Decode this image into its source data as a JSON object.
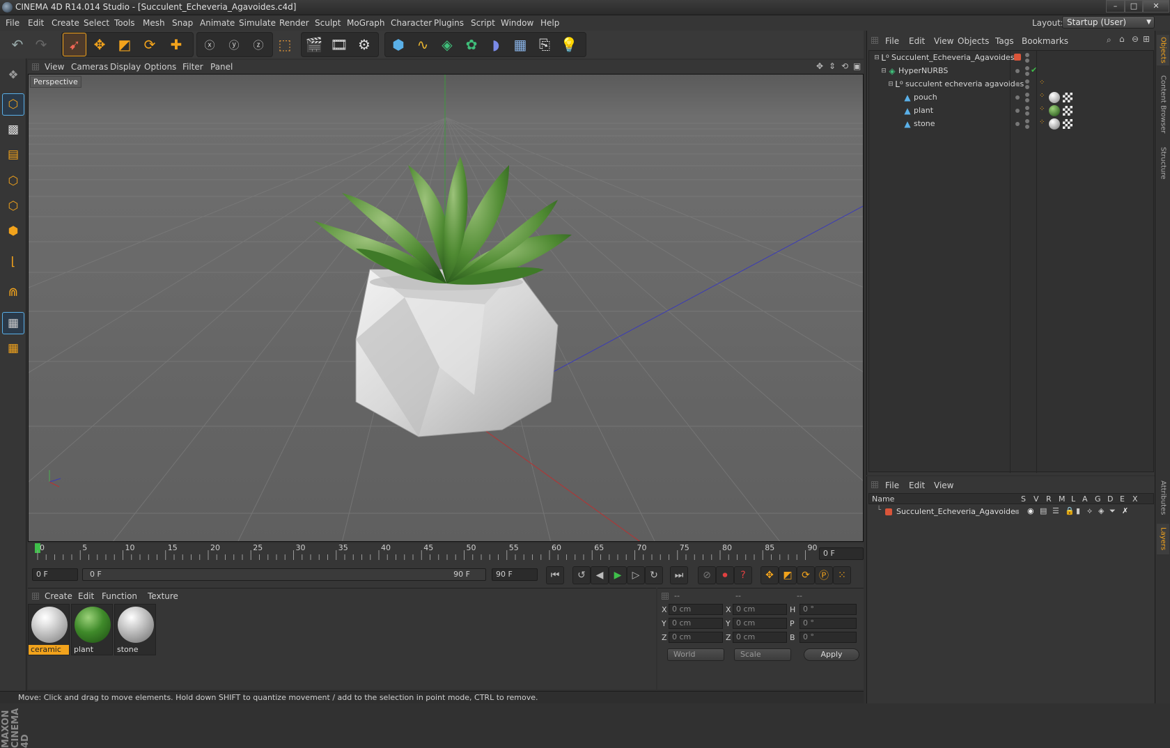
{
  "window": {
    "title": "CINEMA 4D R14.014 Studio - [Succulent_Echeveria_Agavoides.c4d]",
    "minimize": "–",
    "maximize": "□",
    "close": "✕"
  },
  "menu": [
    "File",
    "Edit",
    "Create",
    "Select",
    "Tools",
    "Mesh",
    "Snap",
    "Animate",
    "Simulate",
    "Render",
    "Sculpt",
    "MoGraph",
    "Character",
    "Plugins",
    "Script",
    "Window",
    "Help"
  ],
  "layout": {
    "label": "Layout:",
    "value": "Startup (User)"
  },
  "toolbar_icons": [
    "undo-icon",
    "redo-icon",
    "live-selection-icon",
    "move-icon",
    "scale-icon",
    "rotate-icon",
    "add-icon",
    "x-axis-lock-icon",
    "y-axis-lock-icon",
    "z-axis-lock-icon",
    "coordinate-system-icon",
    "render-view-icon",
    "render-picture-viewer-icon",
    "render-settings-icon",
    "cube-icon",
    "spline-icon",
    "nurbs-icon",
    "array-icon",
    "deformer-icon",
    "floor-icon",
    "camera-icon",
    "light-icon"
  ],
  "viewport": {
    "menu": [
      "View",
      "Cameras",
      "Display",
      "Options",
      "Filter",
      "Panel"
    ],
    "label": "Perspective"
  },
  "timeline": {
    "ticks": [
      "0",
      "5",
      "10",
      "15",
      "20",
      "25",
      "30",
      "35",
      "40",
      "45",
      "50",
      "55",
      "60",
      "65",
      "70",
      "75",
      "80",
      "85",
      "90"
    ],
    "current_frame": "0 F",
    "start_field": "0 F",
    "range_start": "0 F",
    "range_end": "90 F",
    "end_field": "90 F"
  },
  "materials": {
    "menu": [
      "Create",
      "Edit",
      "Function",
      "Texture"
    ],
    "items": [
      {
        "name": "ceramic",
        "selected": true
      },
      {
        "name": "plant",
        "selected": false
      },
      {
        "name": "stone",
        "selected": false
      }
    ]
  },
  "coords": {
    "headers": [
      "--",
      "--",
      "--"
    ],
    "rows": [
      {
        "a": "X",
        "av": "0 cm",
        "b": "X",
        "bv": "0 cm",
        "c": "H",
        "cv": "0 °"
      },
      {
        "a": "Y",
        "av": "0 cm",
        "b": "Y",
        "bv": "0 cm",
        "c": "P",
        "cv": "0 °"
      },
      {
        "a": "Z",
        "av": "0 cm",
        "b": "Z",
        "bv": "0 cm",
        "c": "B",
        "cv": "0 °"
      }
    ],
    "mode1": "World",
    "mode2": "Scale",
    "apply": "Apply"
  },
  "status": "Move: Click and drag to move elements. Hold down SHIFT to quantize movement / add to the selection in point mode, CTRL to remove.",
  "objects": {
    "menu": [
      "File",
      "Edit",
      "View",
      "Objects",
      "Tags",
      "Bookmarks"
    ],
    "tree": [
      {
        "name": "Succulent_Echeveria_Agavoides",
        "icon": "null-object-icon"
      },
      {
        "name": "HyperNURBS",
        "icon": "hypernurbs-icon"
      },
      {
        "name": "succulent echeveria agavoides",
        "icon": "null-object-icon"
      },
      {
        "name": "pouch",
        "icon": "polygon-object-icon"
      },
      {
        "name": "plant",
        "icon": "polygon-object-icon"
      },
      {
        "name": "stone",
        "icon": "polygon-object-icon"
      }
    ]
  },
  "layers": {
    "menu": [
      "File",
      "Edit",
      "View"
    ],
    "columns": [
      "Name",
      "S",
      "V",
      "R",
      "M",
      "L",
      "A",
      "G",
      "D",
      "E",
      "X"
    ],
    "items": [
      {
        "name": "Succulent_Echeveria_Agavoides",
        "color": "#d9553a"
      }
    ]
  },
  "side_tabs": [
    "Objects",
    "Content Browser",
    "Structure",
    "Attributes",
    "Layers"
  ],
  "brand": "MAXON CINEMA 4D",
  "colors": {
    "accent": "#f2a31c",
    "layer": "#d9553a"
  }
}
